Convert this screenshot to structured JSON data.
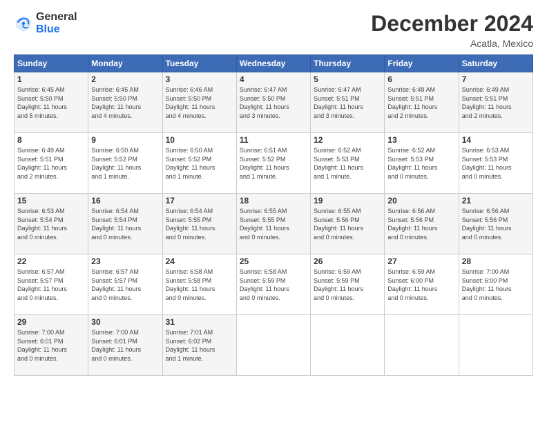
{
  "logo": {
    "general": "General",
    "blue": "Blue"
  },
  "header": {
    "month": "December 2024",
    "location": "Acatla, Mexico"
  },
  "weekdays": [
    "Sunday",
    "Monday",
    "Tuesday",
    "Wednesday",
    "Thursday",
    "Friday",
    "Saturday"
  ],
  "weeks": [
    [
      {
        "day": "1",
        "info": "Sunrise: 6:45 AM\nSunset: 5:50 PM\nDaylight: 11 hours\nand 5 minutes."
      },
      {
        "day": "2",
        "info": "Sunrise: 6:45 AM\nSunset: 5:50 PM\nDaylight: 11 hours\nand 4 minutes."
      },
      {
        "day": "3",
        "info": "Sunrise: 6:46 AM\nSunset: 5:50 PM\nDaylight: 11 hours\nand 4 minutes."
      },
      {
        "day": "4",
        "info": "Sunrise: 6:47 AM\nSunset: 5:50 PM\nDaylight: 11 hours\nand 3 minutes."
      },
      {
        "day": "5",
        "info": "Sunrise: 6:47 AM\nSunset: 5:51 PM\nDaylight: 11 hours\nand 3 minutes."
      },
      {
        "day": "6",
        "info": "Sunrise: 6:48 AM\nSunset: 5:51 PM\nDaylight: 11 hours\nand 2 minutes."
      },
      {
        "day": "7",
        "info": "Sunrise: 6:49 AM\nSunset: 5:51 PM\nDaylight: 11 hours\nand 2 minutes."
      }
    ],
    [
      {
        "day": "8",
        "info": "Sunrise: 6:49 AM\nSunset: 5:51 PM\nDaylight: 11 hours\nand 2 minutes."
      },
      {
        "day": "9",
        "info": "Sunrise: 6:50 AM\nSunset: 5:52 PM\nDaylight: 11 hours\nand 1 minute."
      },
      {
        "day": "10",
        "info": "Sunrise: 6:50 AM\nSunset: 5:52 PM\nDaylight: 11 hours\nand 1 minute."
      },
      {
        "day": "11",
        "info": "Sunrise: 6:51 AM\nSunset: 5:52 PM\nDaylight: 11 hours\nand 1 minute."
      },
      {
        "day": "12",
        "info": "Sunrise: 6:52 AM\nSunset: 5:53 PM\nDaylight: 11 hours\nand 1 minute."
      },
      {
        "day": "13",
        "info": "Sunrise: 6:52 AM\nSunset: 5:53 PM\nDaylight: 11 hours\nand 0 minutes."
      },
      {
        "day": "14",
        "info": "Sunrise: 6:53 AM\nSunset: 5:53 PM\nDaylight: 11 hours\nand 0 minutes."
      }
    ],
    [
      {
        "day": "15",
        "info": "Sunrise: 6:53 AM\nSunset: 5:54 PM\nDaylight: 11 hours\nand 0 minutes."
      },
      {
        "day": "16",
        "info": "Sunrise: 6:54 AM\nSunset: 5:54 PM\nDaylight: 11 hours\nand 0 minutes."
      },
      {
        "day": "17",
        "info": "Sunrise: 6:54 AM\nSunset: 5:55 PM\nDaylight: 11 hours\nand 0 minutes."
      },
      {
        "day": "18",
        "info": "Sunrise: 6:55 AM\nSunset: 5:55 PM\nDaylight: 11 hours\nand 0 minutes."
      },
      {
        "day": "19",
        "info": "Sunrise: 6:55 AM\nSunset: 5:56 PM\nDaylight: 11 hours\nand 0 minutes."
      },
      {
        "day": "20",
        "info": "Sunrise: 6:56 AM\nSunset: 5:56 PM\nDaylight: 11 hours\nand 0 minutes."
      },
      {
        "day": "21",
        "info": "Sunrise: 6:56 AM\nSunset: 5:56 PM\nDaylight: 11 hours\nand 0 minutes."
      }
    ],
    [
      {
        "day": "22",
        "info": "Sunrise: 6:57 AM\nSunset: 5:57 PM\nDaylight: 11 hours\nand 0 minutes."
      },
      {
        "day": "23",
        "info": "Sunrise: 6:57 AM\nSunset: 5:57 PM\nDaylight: 11 hours\nand 0 minutes."
      },
      {
        "day": "24",
        "info": "Sunrise: 6:58 AM\nSunset: 5:58 PM\nDaylight: 11 hours\nand 0 minutes."
      },
      {
        "day": "25",
        "info": "Sunrise: 6:58 AM\nSunset: 5:59 PM\nDaylight: 11 hours\nand 0 minutes."
      },
      {
        "day": "26",
        "info": "Sunrise: 6:59 AM\nSunset: 5:59 PM\nDaylight: 11 hours\nand 0 minutes."
      },
      {
        "day": "27",
        "info": "Sunrise: 6:59 AM\nSunset: 6:00 PM\nDaylight: 11 hours\nand 0 minutes."
      },
      {
        "day": "28",
        "info": "Sunrise: 7:00 AM\nSunset: 6:00 PM\nDaylight: 11 hours\nand 0 minutes."
      }
    ],
    [
      {
        "day": "29",
        "info": "Sunrise: 7:00 AM\nSunset: 6:01 PM\nDaylight: 11 hours\nand 0 minutes."
      },
      {
        "day": "30",
        "info": "Sunrise: 7:00 AM\nSunset: 6:01 PM\nDaylight: 11 hours\nand 0 minutes."
      },
      {
        "day": "31",
        "info": "Sunrise: 7:01 AM\nSunset: 6:02 PM\nDaylight: 11 hours\nand 1 minute."
      },
      {
        "day": "",
        "info": ""
      },
      {
        "day": "",
        "info": ""
      },
      {
        "day": "",
        "info": ""
      },
      {
        "day": "",
        "info": ""
      }
    ]
  ]
}
